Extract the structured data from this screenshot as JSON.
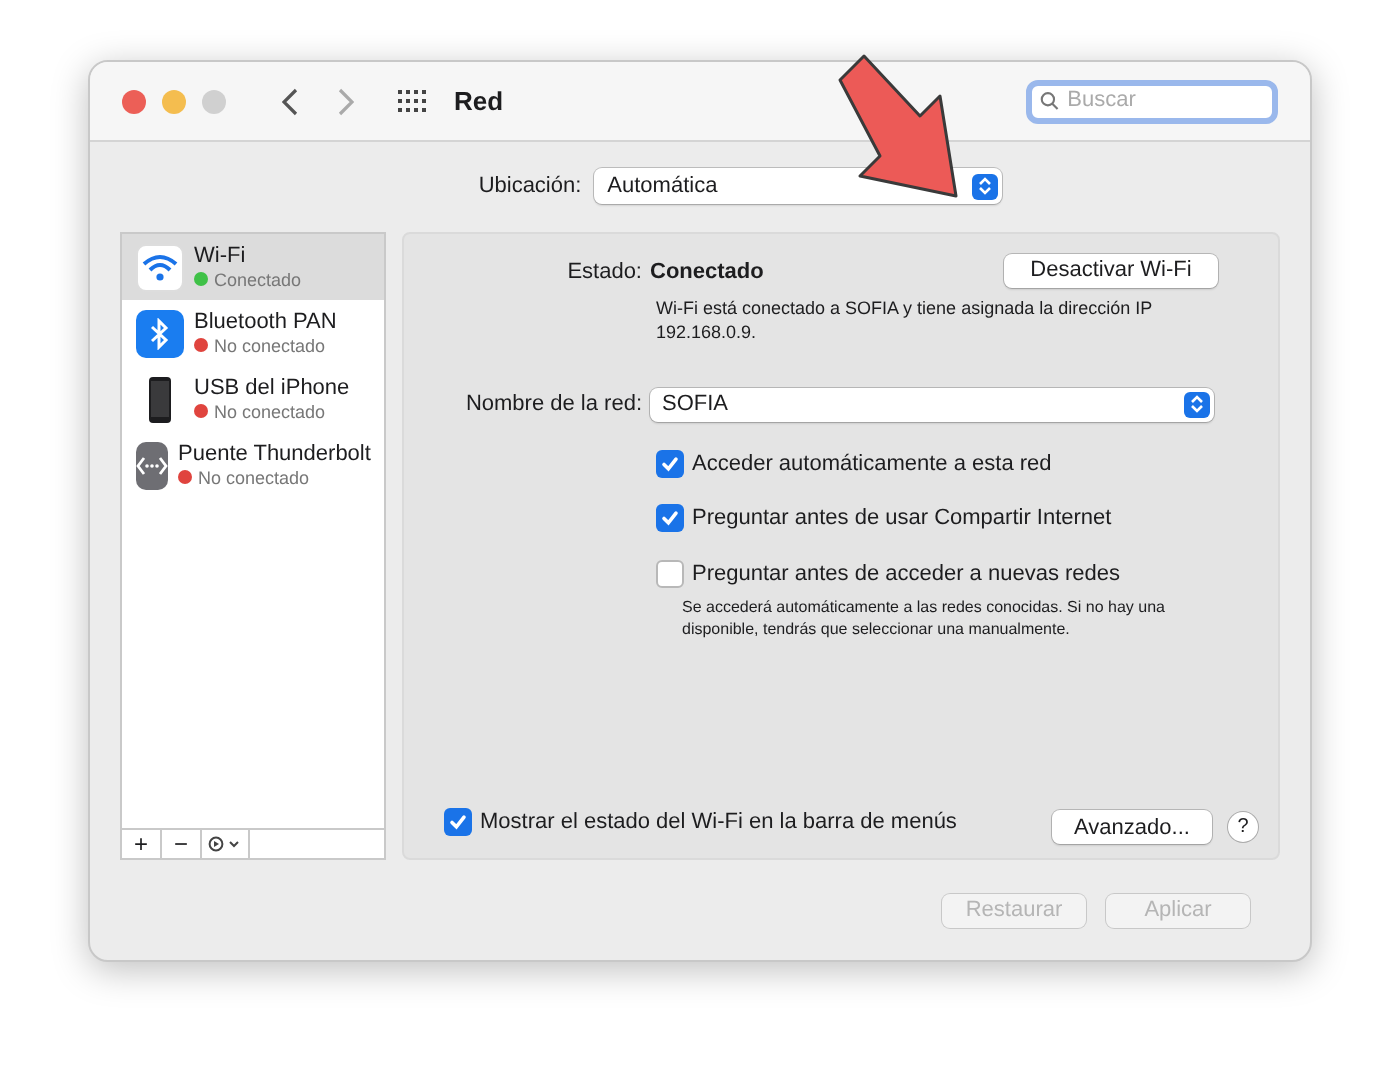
{
  "window": {
    "title": "Red",
    "traffic_lights": [
      {
        "color": "#ec5f57"
      },
      {
        "color": "#f4bd4f"
      },
      {
        "color": "#d0d0d0"
      }
    ]
  },
  "search": {
    "placeholder": "Buscar"
  },
  "location": {
    "label": "Ubicación:",
    "value": "Automática"
  },
  "services": [
    {
      "kind": "wifi",
      "name": "Wi-Fi",
      "status": "Conectado",
      "color": "#3fc147",
      "selected": true
    },
    {
      "kind": "bluetooth",
      "name": "Bluetooth PAN",
      "status": "No conectado",
      "color": "#e0443e",
      "selected": false
    },
    {
      "kind": "phone",
      "name": "USB del iPhone",
      "status": "No conectado",
      "color": "#e0443e",
      "selected": false
    },
    {
      "kind": "bridge",
      "name": "Puente Thunderbolt",
      "status": "No conectado",
      "color": "#e0443e",
      "selected": false
    }
  ],
  "sidebar_toolbar": [
    "+",
    "−"
  ],
  "status": {
    "label": "Estado:",
    "value": "Conectado",
    "button": "Desactivar Wi-Fi",
    "description": "Wi-Fi está conectado a SOFIA y tiene asignada la dirección IP 192.168.0.9."
  },
  "network": {
    "label": "Nombre de la red:",
    "value": "SOFIA"
  },
  "options": [
    {
      "label": "Acceder automáticamente a esta red",
      "checked": true
    },
    {
      "label": "Preguntar antes de usar Compartir Internet",
      "checked": true
    },
    {
      "label": "Preguntar antes de acceder a nuevas redes",
      "checked": false,
      "note": "Se accederá automáticamente a las redes conocidas. Si no hay una disponible, tendrás que seleccionar una manualmente."
    }
  ],
  "menu_bar_option": {
    "label": "Mostrar el estado del Wi-Fi en la barra de menús",
    "checked": true
  },
  "advanced_button": "Avanzado...",
  "help_button": "?",
  "footer_buttons": [
    {
      "label": "Restaurar",
      "disabled": true
    },
    {
      "label": "Aplicar",
      "disabled": true
    }
  ]
}
